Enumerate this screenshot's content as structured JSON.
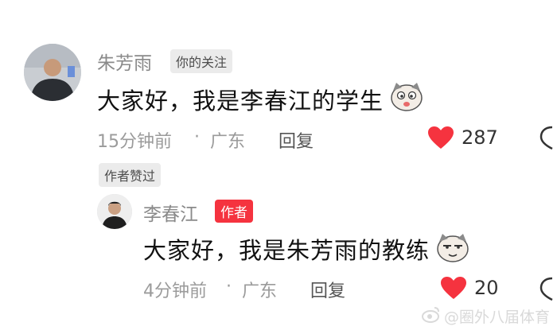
{
  "comments": [
    {
      "author": "朱芳雨",
      "tag": "你的关注",
      "text": "大家好，我是李春江的学生",
      "time": "15分钟前",
      "dot": "·",
      "location": "广东",
      "reply_label": "回复",
      "likes": "287",
      "emoji_icon": "cat-face-emoji",
      "like_icon": "heart-icon"
    },
    {
      "badge": "作者赞过",
      "author": "李春江",
      "tag": "作者",
      "text": "大家好，我是朱芳雨的教练",
      "time": "4分钟前",
      "dot": "·",
      "location": "广东",
      "reply_label": "回复",
      "likes": "20",
      "emoji_icon": "cat-face-emoji",
      "like_icon": "heart-icon"
    }
  ],
  "watermark": "@圈外八届体育",
  "colors": {
    "like_red": "#f5333f",
    "tag_red": "#f5333f"
  }
}
